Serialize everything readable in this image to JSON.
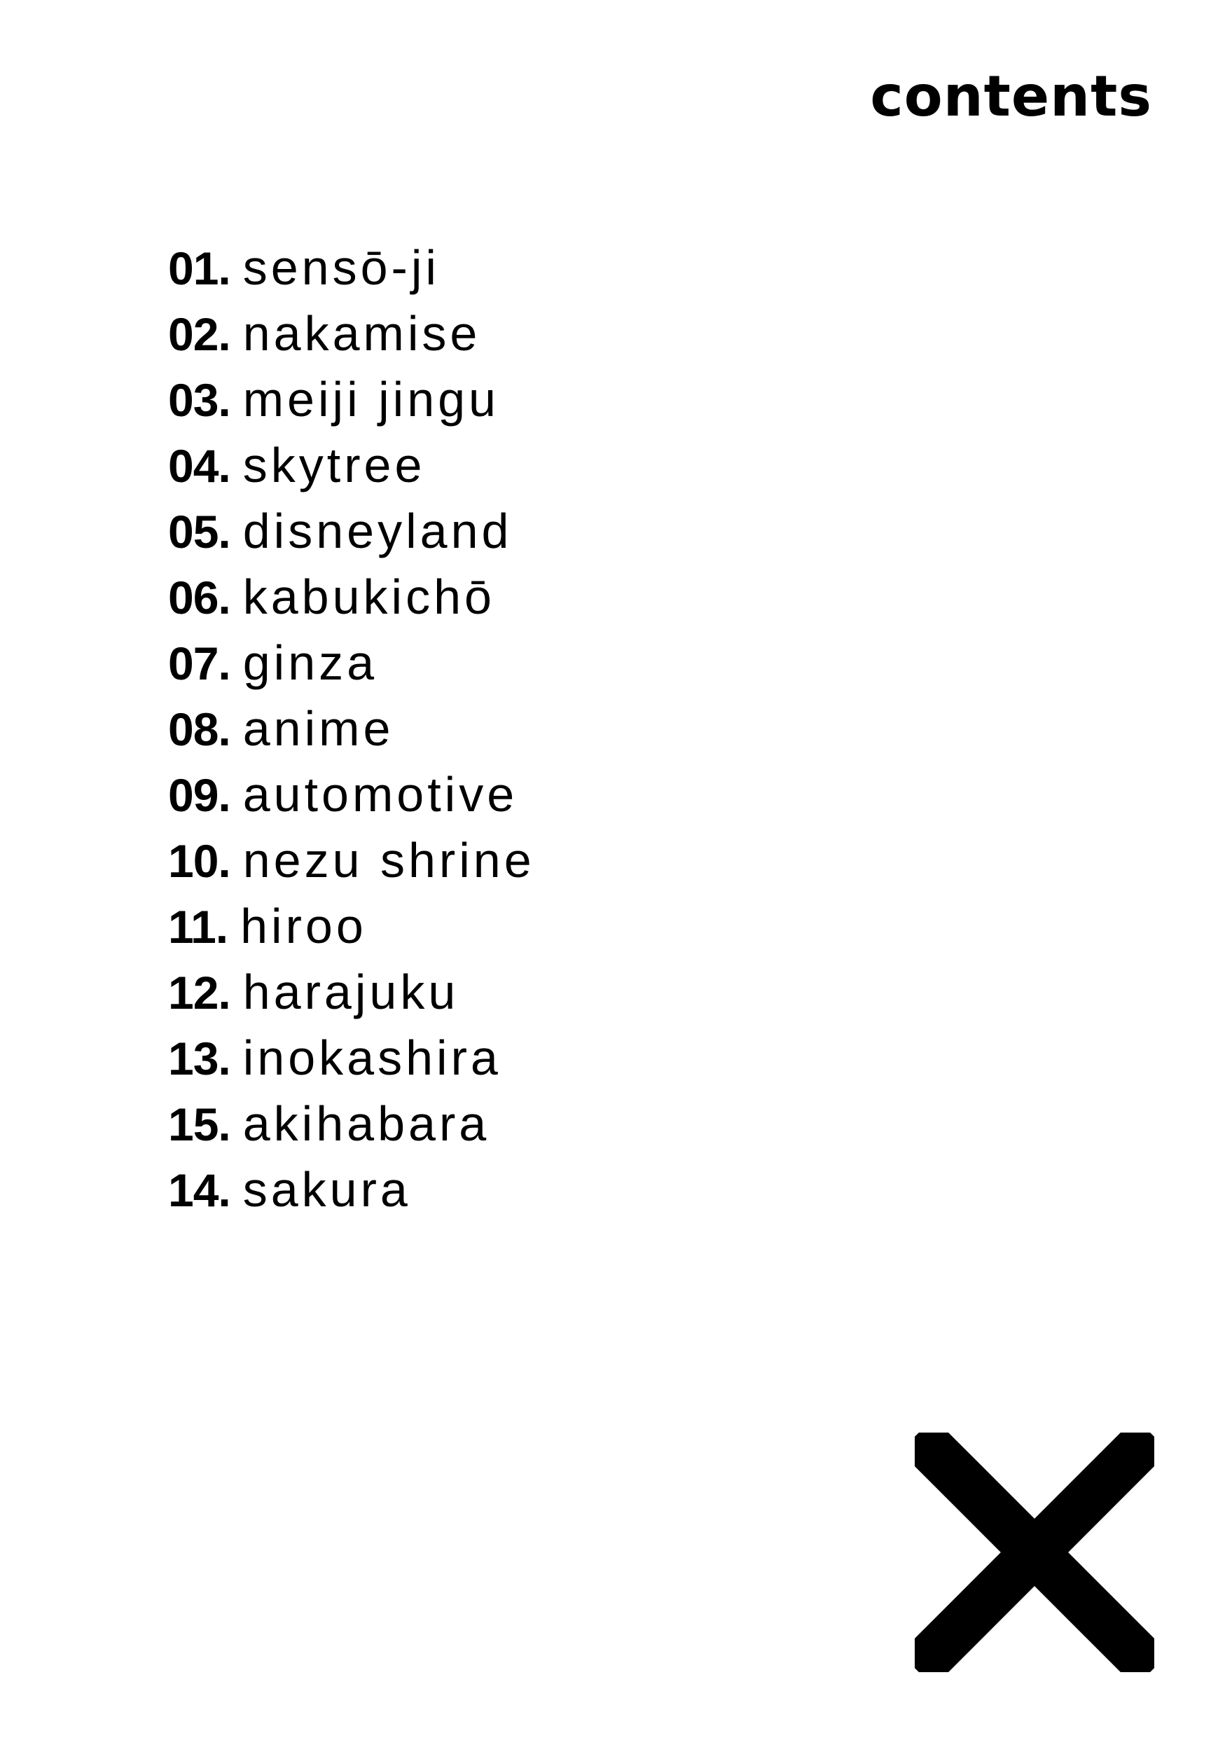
{
  "header": {
    "title": "contents"
  },
  "toc": {
    "items": [
      {
        "number": "01.",
        "label": "sensō-ji"
      },
      {
        "number": "02.",
        "label": "nakamise"
      },
      {
        "number": "03.",
        "label": "meiji jingu"
      },
      {
        "number": "04.",
        "label": "skytree"
      },
      {
        "number": "05.",
        "label": "disneyland"
      },
      {
        "number": "06.",
        "label": "kabukichō"
      },
      {
        "number": "07.",
        "label": "ginza"
      },
      {
        "number": "08.",
        "label": "anime"
      },
      {
        "number": "09.",
        "label": "automotive"
      },
      {
        "number": "10.",
        "label": "nezu shrine"
      },
      {
        "number": "11.",
        "label": "hiroo"
      },
      {
        "number": "12.",
        "label": "harajuku"
      },
      {
        "number": "13.",
        "label": "inokashira"
      },
      {
        "number": "15.",
        "label": "akihabara"
      },
      {
        "number": "14.",
        "label": "sakura"
      }
    ]
  },
  "footer": {
    "mark_icon": "close-icon"
  },
  "colors": {
    "background": "#ffffff",
    "text": "#000000"
  }
}
